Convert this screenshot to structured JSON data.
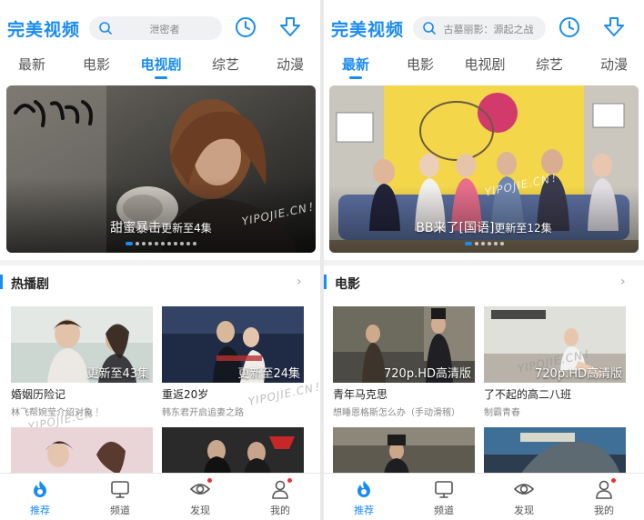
{
  "colors": {
    "accent": "#1a8bf0",
    "badge_dot": "#f0302a"
  },
  "panes": [
    {
      "logo": "完美视频",
      "search_placeholder": "泄密者",
      "tabs": [
        "最新",
        "电影",
        "电视剧",
        "综艺",
        "动漫"
      ],
      "active_tab": 2,
      "banner": {
        "title": "甜蜜暴击",
        "update": "更新至4集",
        "watermark": "YIPOJIE.CN！",
        "dots": 11,
        "active_dot": 0
      },
      "section_title": "热播剧",
      "cards": [
        {
          "badge": "更新至43集",
          "title": "婚姻历险记",
          "subtitle": "林飞帮婉莹介绍对象"
        },
        {
          "badge": "更新至24集",
          "title": "重返20岁",
          "subtitle": "韩东君开启追妻之路"
        }
      ],
      "watermark2": "YIPOJIE.CN！",
      "watermark3": "YIPOJIE.CN！",
      "nav": [
        {
          "label": "推荐",
          "icon": "recommend-icon",
          "dot": false
        },
        {
          "label": "频道",
          "icon": "channel-tv-icon",
          "dot": false
        },
        {
          "label": "发现",
          "icon": "discover-eye-icon",
          "dot": true
        },
        {
          "label": "我的",
          "icon": "profile-icon",
          "dot": true
        }
      ]
    },
    {
      "logo": "完美视频",
      "search_placeholder": "古墓丽影：源起之战",
      "tabs": [
        "最新",
        "电影",
        "电视剧",
        "综艺",
        "动漫"
      ],
      "active_tab": 0,
      "banner": {
        "title": "BB来了[国语]",
        "update": "更新至12集",
        "watermark": "YIPOJIE.CN！",
        "dots": 6,
        "active_dot": 0
      },
      "section_title": "电影",
      "cards": [
        {
          "badge": "720p.HD高清版",
          "title": "青年马克思",
          "subtitle": "想睡恩格斯怎么办（手动滑稽）"
        },
        {
          "badge": "720p.HD高清版",
          "title": "了不起的高二八班",
          "subtitle": "制霸青春"
        }
      ],
      "watermark2": "YIPOJIE.CN！",
      "watermark3": "",
      "nav": [
        {
          "label": "推荐",
          "icon": "recommend-icon",
          "dot": false
        },
        {
          "label": "频道",
          "icon": "channel-tv-icon",
          "dot": false
        },
        {
          "label": "发现",
          "icon": "discover-eye-icon",
          "dot": false
        },
        {
          "label": "我的",
          "icon": "profile-icon",
          "dot": true
        }
      ]
    }
  ]
}
